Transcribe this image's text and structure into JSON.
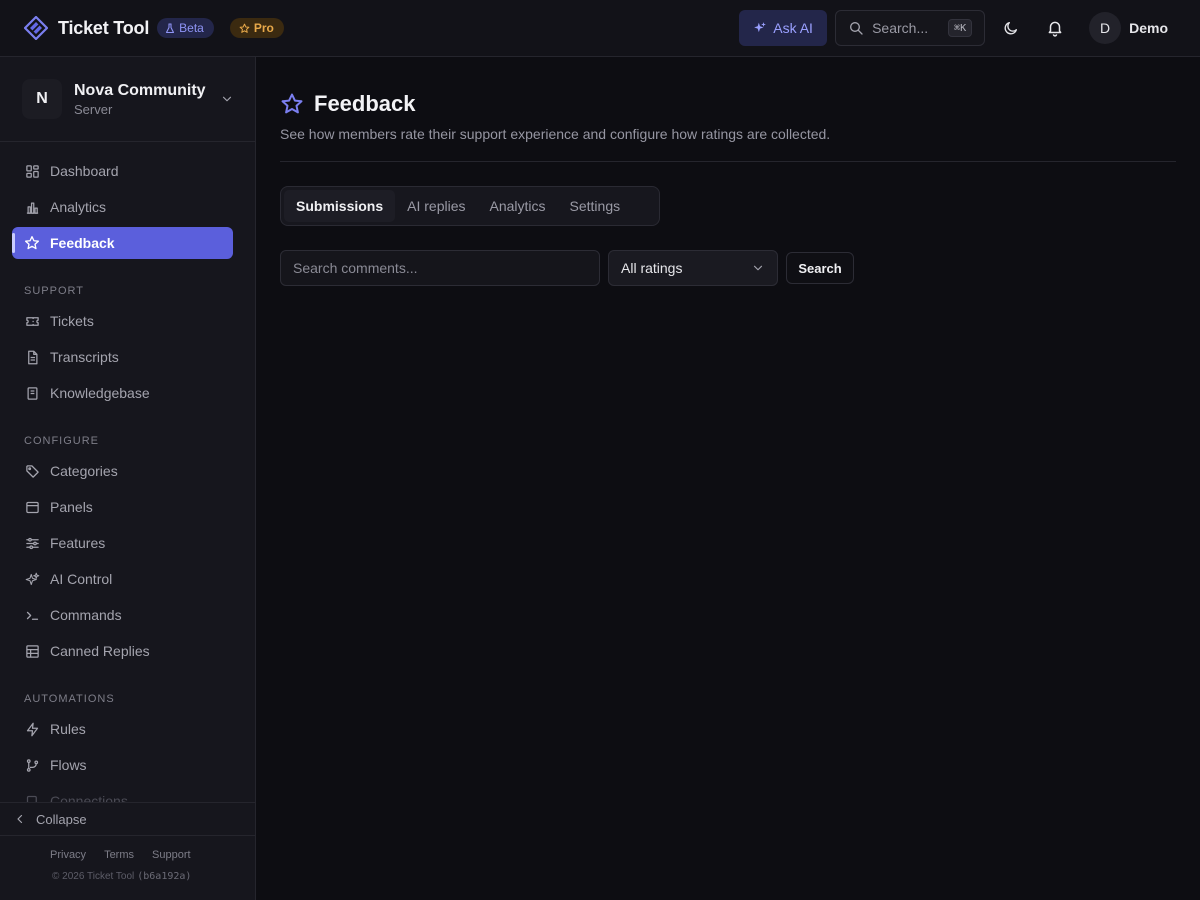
{
  "app": {
    "name": "Ticket Tool",
    "beta_badge": "Beta",
    "pro_badge": "Pro",
    "brand_color": "#5b5fdc"
  },
  "topbar": {
    "ask_ai_label": "Ask AI",
    "search_label": "Search...",
    "search_shortcut": "⌘K",
    "theme_icon": "moon-icon",
    "notifications_icon": "bell-icon",
    "user_initial": "D",
    "user_name": "Demo"
  },
  "server": {
    "initial": "N",
    "name": "Nova Community",
    "subtitle": "Server"
  },
  "sidebar": {
    "items": [
      {
        "label": "Dashboard",
        "icon": "dashboard-icon"
      },
      {
        "label": "Analytics",
        "icon": "bar-chart-icon"
      },
      {
        "label": "Feedback",
        "icon": "star-icon",
        "active": true
      }
    ],
    "sections": [
      {
        "title": "SUPPORT",
        "items": [
          {
            "label": "Tickets",
            "icon": "ticket-icon"
          },
          {
            "label": "Transcripts",
            "icon": "file-text-icon"
          },
          {
            "label": "Knowledgebase",
            "icon": "book-icon"
          }
        ]
      },
      {
        "title": "CONFIGURE",
        "items": [
          {
            "label": "Categories",
            "icon": "tag-icon"
          },
          {
            "label": "Panels",
            "icon": "panel-icon"
          },
          {
            "label": "Features",
            "icon": "sliders-icon"
          },
          {
            "label": "AI Control",
            "icon": "sparkles-icon"
          },
          {
            "label": "Commands",
            "icon": "terminal-icon"
          },
          {
            "label": "Canned Replies",
            "icon": "list-icon"
          }
        ]
      },
      {
        "title": "AUTOMATIONS",
        "items": [
          {
            "label": "Rules",
            "icon": "bolt-icon"
          },
          {
            "label": "Flows",
            "icon": "git-branch-icon"
          },
          {
            "label": "Connections",
            "icon": "plug-icon"
          }
        ]
      }
    ],
    "collapse_label": "Collapse",
    "footer_links": [
      "Privacy",
      "Terms",
      "Support"
    ],
    "copyright": "© 2026 Ticket Tool",
    "build_hash": "(b6a192a)"
  },
  "page": {
    "title": "Feedback",
    "subtitle": "See how members rate their support experience and configure how ratings are collected.",
    "tabs": [
      {
        "label": "Submissions",
        "active": true
      },
      {
        "label": "AI replies"
      },
      {
        "label": "Analytics"
      },
      {
        "label": "Settings"
      }
    ],
    "filters": {
      "search_placeholder": "Search comments...",
      "search_value": "",
      "rating_selected": "All ratings",
      "search_button": "Search"
    }
  }
}
